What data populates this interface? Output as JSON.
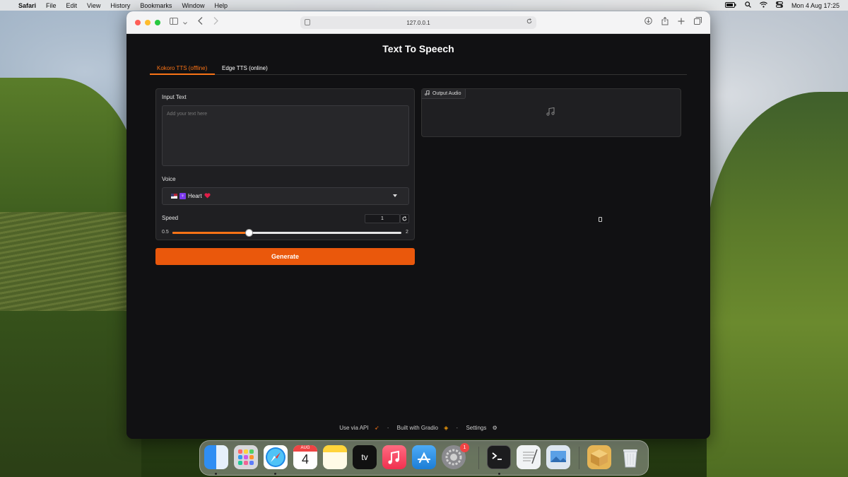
{
  "menubar": {
    "app": "Safari",
    "items": [
      "File",
      "Edit",
      "View",
      "History",
      "Bookmarks",
      "Window",
      "Help"
    ],
    "datetime": "Mon 4 Aug  17:25"
  },
  "browser": {
    "url": "127.0.0.1"
  },
  "app": {
    "title": "Text To Speech",
    "tabs": [
      {
        "label": "Kokoro TTS (offline)",
        "active": true
      },
      {
        "label": "Edge TTS (online)",
        "active": false
      }
    ],
    "input_text": {
      "label": "Input Text",
      "placeholder": "Add your text here"
    },
    "voice": {
      "label": "Voice",
      "selected": "Heart"
    },
    "speed": {
      "label": "Speed",
      "value": "1",
      "min": "0.5",
      "max": "2",
      "fraction": 0.333
    },
    "generate_label": "Generate",
    "output": {
      "label": "Output Audio"
    },
    "footer": {
      "api": "Use via API",
      "built": "Built with Gradio",
      "settings": "Settings",
      "sep": "·"
    }
  },
  "dock": {
    "calendar_month": "AUG",
    "calendar_day": "4",
    "tv_label": "tv",
    "settings_badge": "1"
  }
}
